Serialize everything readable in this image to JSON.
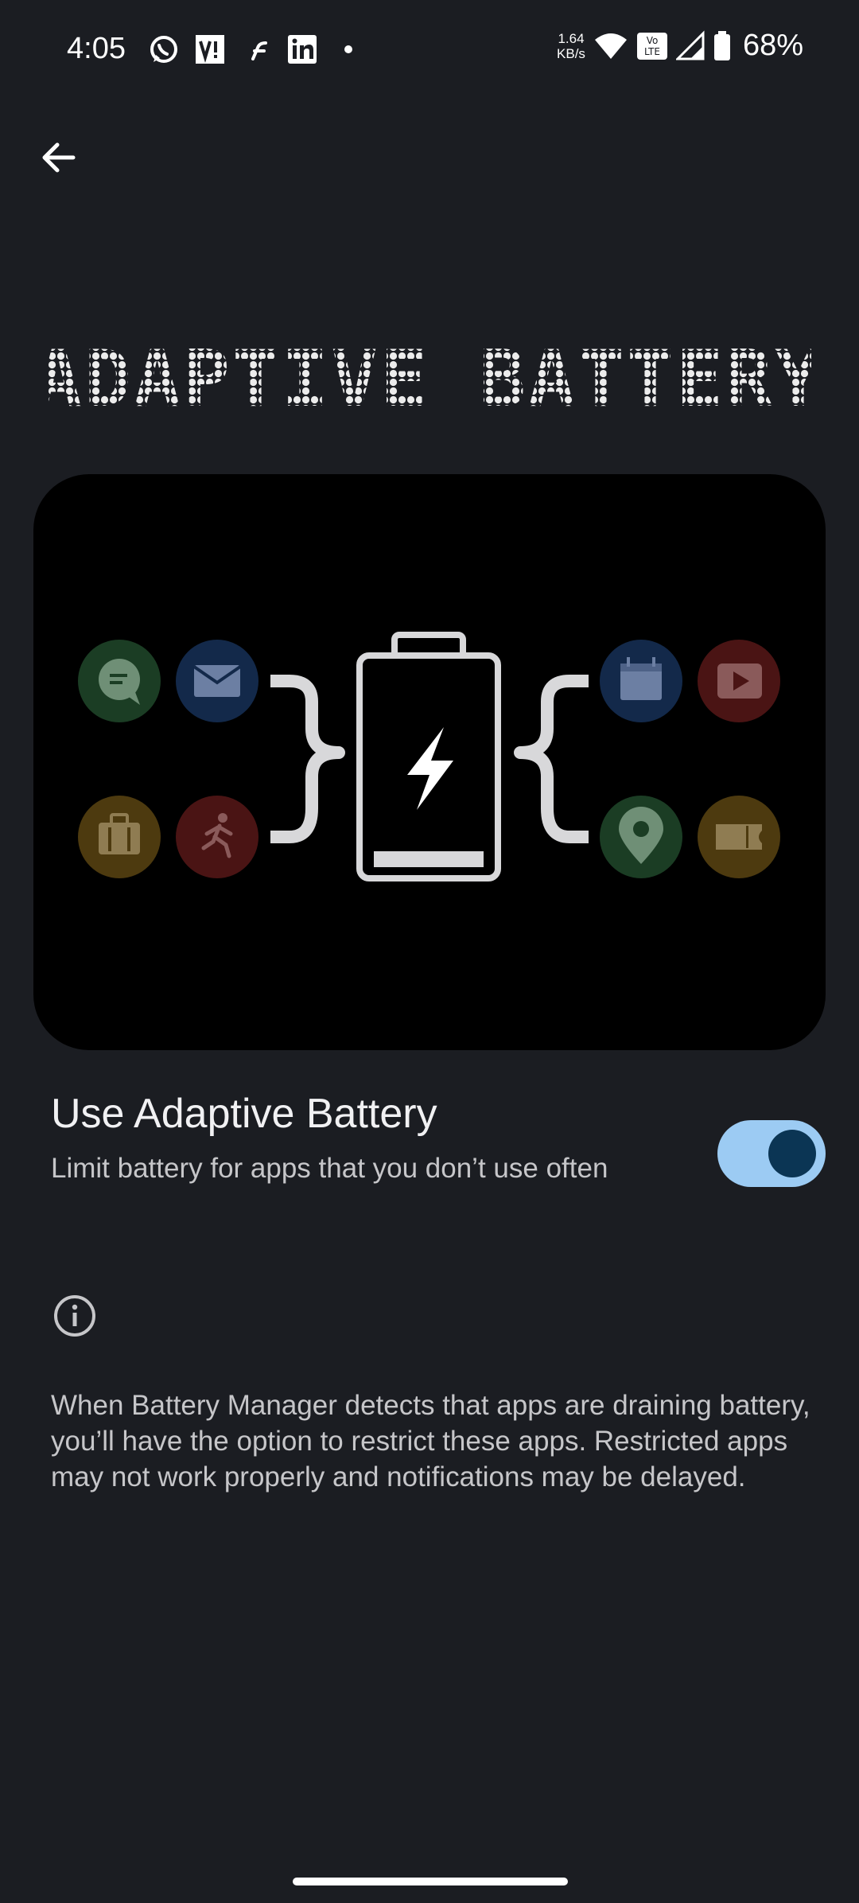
{
  "status_bar": {
    "time": "4:05",
    "net_speed_value": "1.64",
    "net_speed_unit": "KB/s",
    "volte_label_top": "Vo",
    "volte_label_bottom": "LTE",
    "battery_percent": "68%",
    "notification_icons": [
      "whatsapp-icon",
      "vi-icon",
      "flipkart-icon",
      "linkedin-icon",
      "dot-icon"
    ]
  },
  "header": {
    "title": "ADAPTIVE BATTERY"
  },
  "illustration": {
    "left_apps": [
      "messages-icon",
      "mail-icon",
      "briefcase-icon",
      "fitness-icon"
    ],
    "right_apps": [
      "calendar-icon",
      "video-icon",
      "maps-icon",
      "ticket-icon"
    ]
  },
  "setting": {
    "title": "Use Adaptive Battery",
    "subtitle": "Limit battery for apps that you don’t use often",
    "enabled": true
  },
  "info": {
    "text": "When Battery Manager detects that apps are draining battery, you’ll have the option to restrict these apps. Restricted apps may not work properly and notifications may be delayed."
  },
  "colors": {
    "background": "#1b1d22",
    "toggle_track": "#9ccbf3",
    "toggle_knob": "#0b3554"
  }
}
